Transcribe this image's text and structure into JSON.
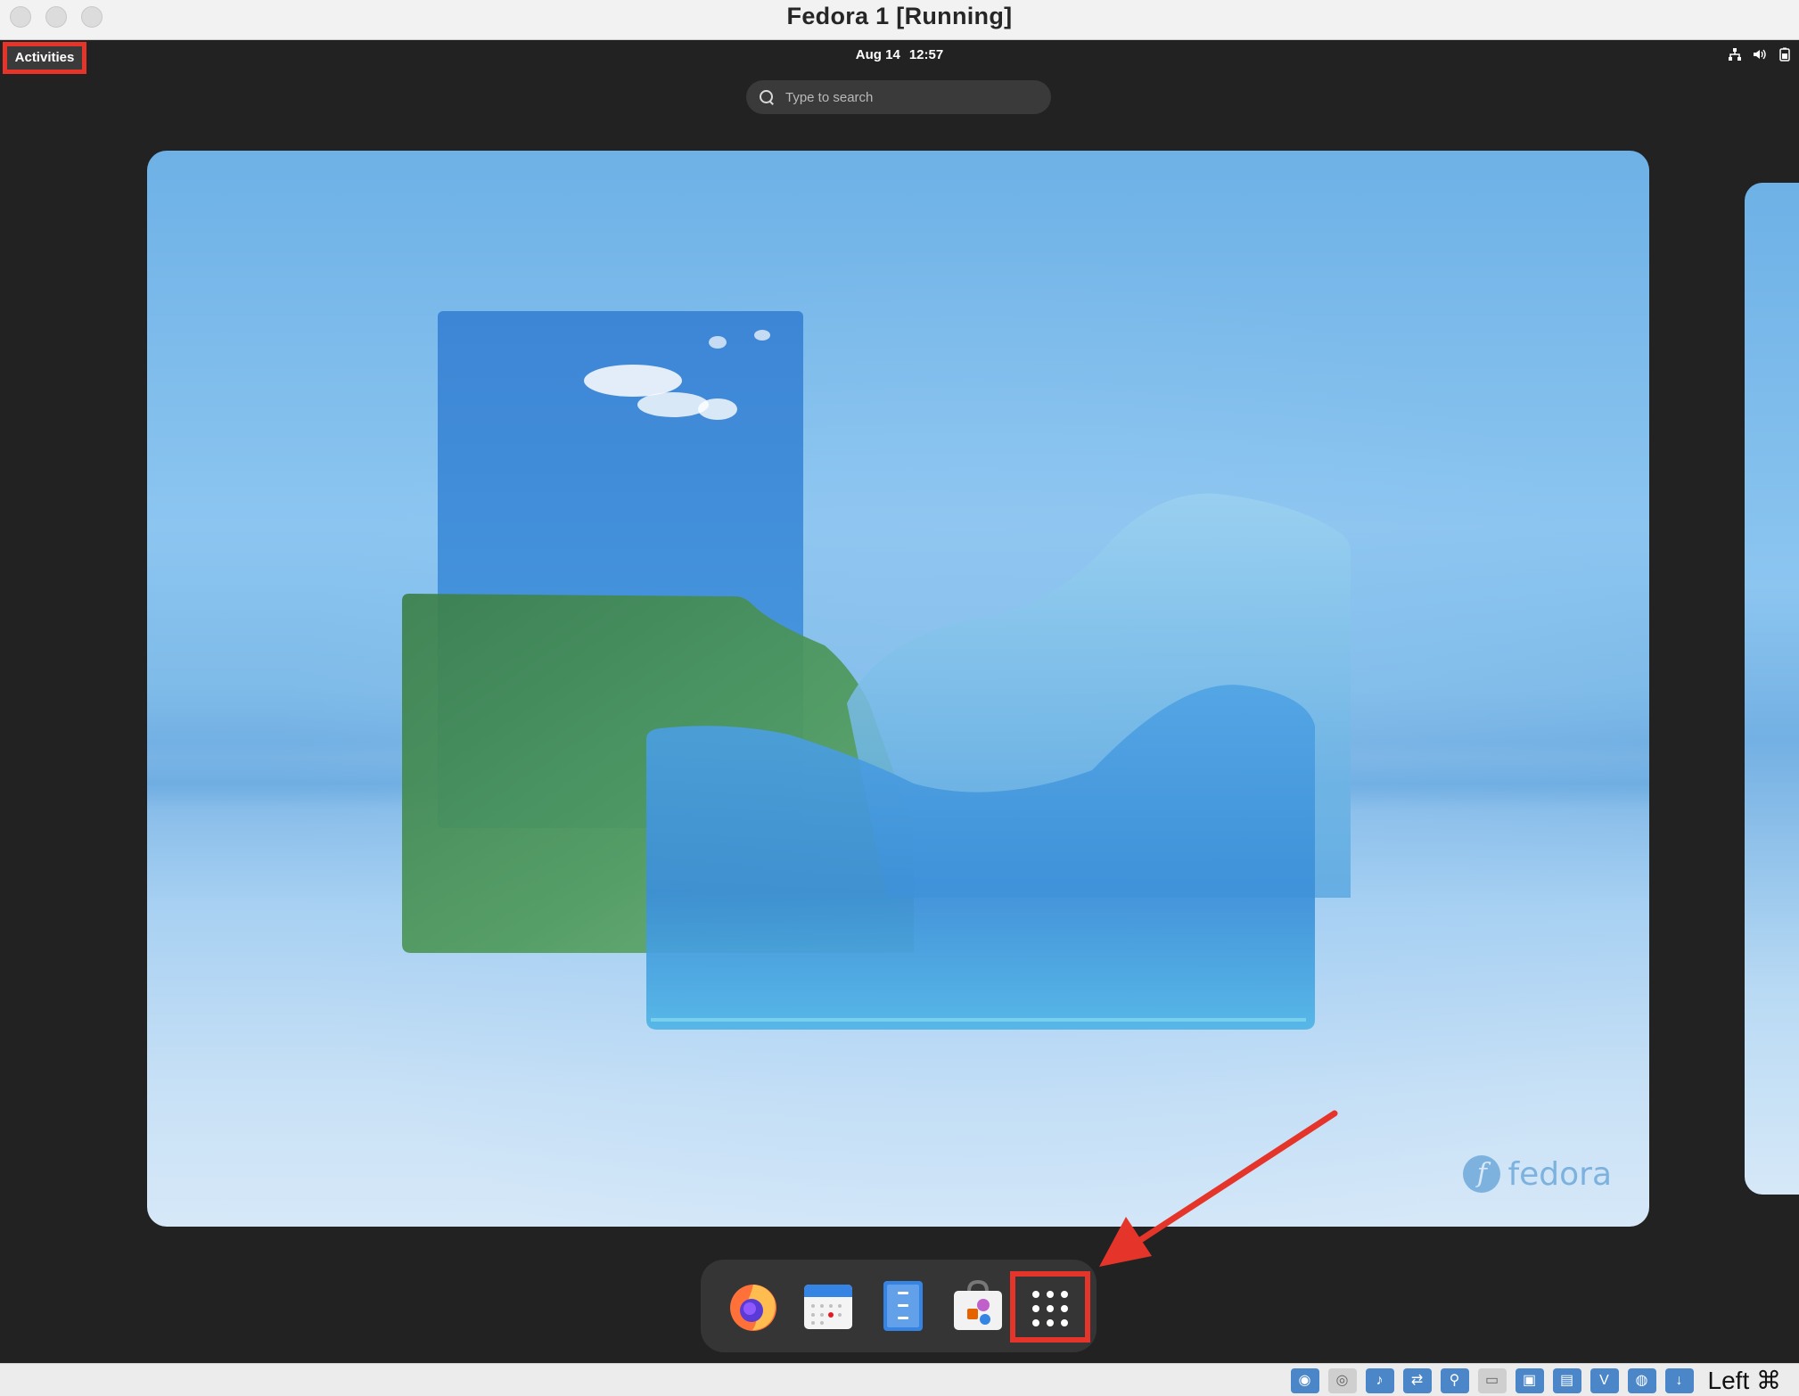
{
  "window": {
    "title": "Fedora 1 [Running]"
  },
  "topbar": {
    "activities_label": "Activities",
    "date": "Aug 14",
    "time": "12:57",
    "tray": {
      "network_icon": "network-icon",
      "volume_icon": "volume-icon",
      "battery_icon": "battery-icon"
    }
  },
  "search": {
    "placeholder": "Type to search",
    "value": ""
  },
  "workspace": {
    "wallpaper": "fedora-glass-wallpaper",
    "watermark": "fedora"
  },
  "dash": {
    "apps": [
      {
        "name": "Firefox",
        "icon": "firefox-icon"
      },
      {
        "name": "Calendar",
        "icon": "calendar-icon"
      },
      {
        "name": "Files",
        "icon": "files-icon"
      },
      {
        "name": "Software",
        "icon": "software-icon"
      },
      {
        "name": "Show Applications",
        "icon": "app-grid-icon"
      }
    ]
  },
  "annotations": {
    "highlight_color": "#e5352a"
  },
  "statusbar": {
    "host_key": "Left ⌘"
  }
}
